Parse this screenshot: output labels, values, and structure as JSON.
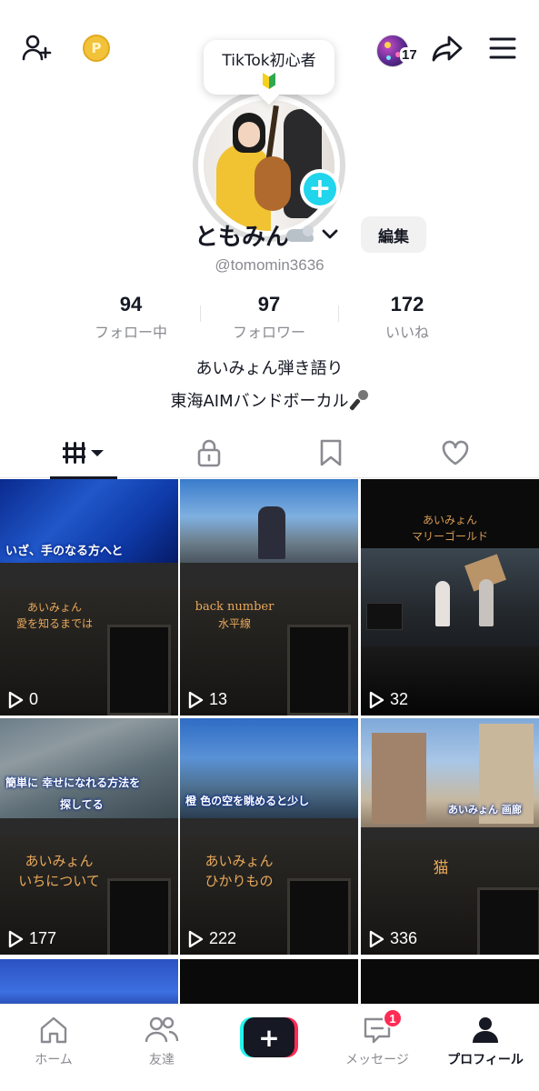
{
  "top_bar": {
    "coin_glyph": "P",
    "visitor_count": "17"
  },
  "tooltip": {
    "text": "TikTok初心者"
  },
  "profile": {
    "display_name": "ともみん",
    "handle": "@tomomin3636",
    "edit_label": "編集"
  },
  "stats": {
    "following_count": "94",
    "following_label": "フォロー中",
    "followers_count": "97",
    "followers_label": "フォロワー",
    "likes_count": "172",
    "likes_label": "いいね"
  },
  "bio": {
    "line1": "あいみょん弾き語り",
    "line2": "東海AIMバンドボーカル"
  },
  "tabs": {
    "videos": "videos-grid-icon",
    "private": "lock-icon",
    "saved": "bookmark-icon",
    "liked": "heart-icon"
  },
  "videos": [
    {
      "subtitle": "いざ、手のなる方へと",
      "title_line1": "あいみょん",
      "title_line2": "愛を知るまでは",
      "views": "0"
    },
    {
      "subtitle": "",
      "title_line1": "back number",
      "title_line2": "水平線",
      "views": "13"
    },
    {
      "subtitle": "",
      "title_line1": "あいみょん",
      "title_line2": "マリーゴールド",
      "views": "32"
    },
    {
      "subtitle": "簡単に 幸せになれる方法を",
      "subtitle2": "探してる",
      "title_line1": "あいみょん",
      "title_line2": "いちについて",
      "views": "177"
    },
    {
      "subtitle": "橙 色の空を眺めると少し",
      "title_line1": "あいみょん",
      "title_line2": "ひかりもの",
      "views": "222"
    },
    {
      "subtitle": "あいみょん 画廊",
      "title_line1": "猫",
      "title_line2": "",
      "views": "336"
    }
  ],
  "bottom_nav": {
    "home": "ホーム",
    "friends": "友達",
    "create": "+",
    "inbox": "メッセージ",
    "inbox_badge": "1",
    "profile": "プロフィール"
  },
  "colors": {
    "accent_cyan": "#25f4ee",
    "accent_red": "#fe2c55",
    "text_primary": "#161823",
    "text_secondary": "#8a8b91",
    "avatar_plus": "#20d5ec",
    "coin": "#f2c23a"
  }
}
